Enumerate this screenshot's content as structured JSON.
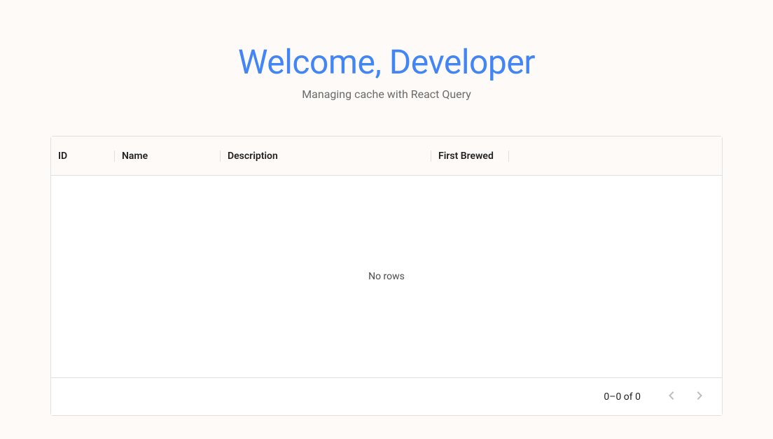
{
  "header": {
    "title": "Welcome, Developer",
    "subtitle": "Managing cache with React Query"
  },
  "grid": {
    "columns": {
      "id": "ID",
      "name": "Name",
      "description": "Description",
      "first_brewed": "First Brewed"
    },
    "empty_message": "No rows",
    "pagination": {
      "info": "0–0 of 0"
    }
  }
}
